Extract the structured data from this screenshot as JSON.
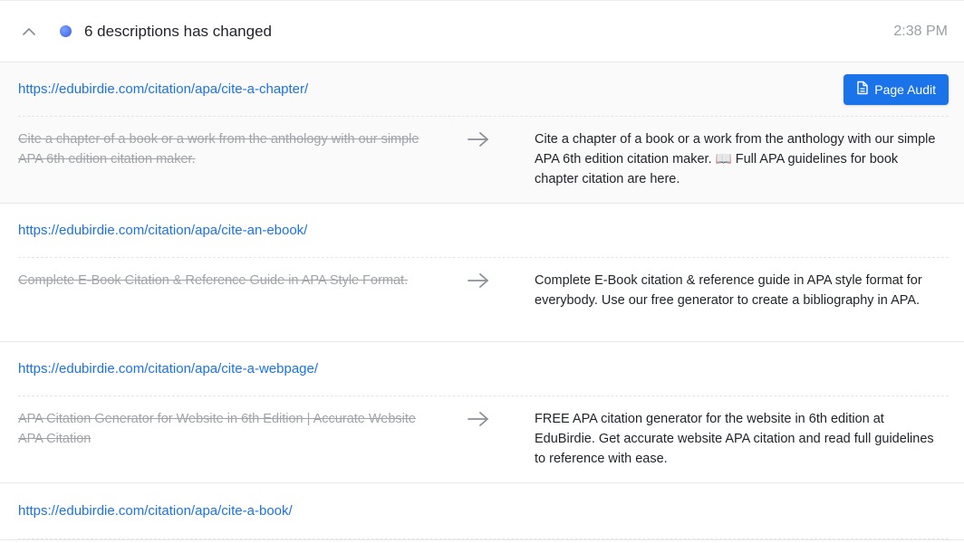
{
  "header": {
    "title": "6 descriptions has changed",
    "time": "2:38 PM"
  },
  "entries": [
    {
      "url": "https://edubirdie.com/citation/apa/cite-a-chapter/",
      "old": "Cite a chapter of a book or a work from the anthology with our simple APA 6th edition citation maker.",
      "new": "Cite a chapter of a book or a work from the anthology with our simple APA 6th edition citation maker. 📖 Full APA guidelines for book chapter citation are here."
    },
    {
      "url": "https://edubirdie.com/citation/apa/cite-an-ebook/",
      "old": "Complete E-Book Citation & Reference Guide in APA Style Format.",
      "new": "Complete E-Book citation & reference guide in APA style format for everybody. Use our free generator to create a bibliography in APA."
    },
    {
      "url": "https://edubirdie.com/citation/apa/cite-a-webpage/",
      "old": "APA Citation Generator for Website in 6th Edition | Accurate Website APA Citation",
      "new": "FREE APA citation generator for the website in 6th edition at EduBirdie. Get accurate website APA citation and read full guidelines to reference with ease."
    },
    {
      "url": "https://edubirdie.com/citation/apa/cite-a-book/"
    }
  ],
  "audit_button": {
    "label": "Page Audit"
  },
  "colors": {
    "accent": "#1a73e8",
    "status_dot": "#3b5bdb",
    "muted_text": "#a0a4a9"
  }
}
